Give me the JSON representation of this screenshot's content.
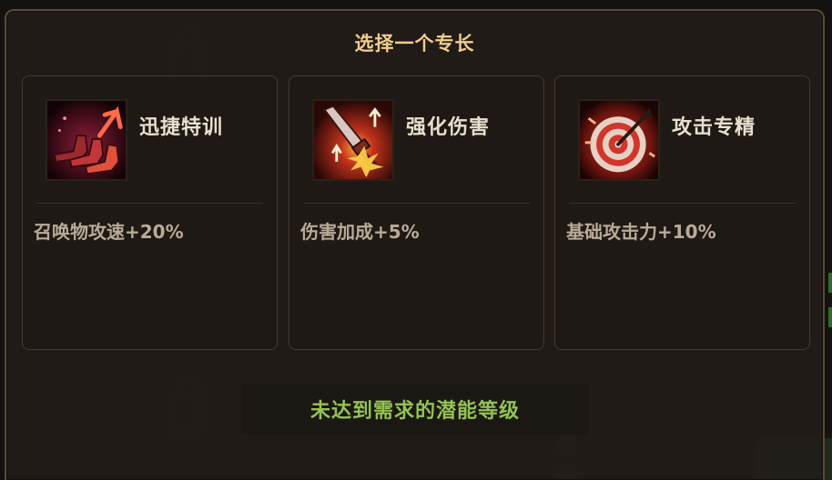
{
  "dialog": {
    "title": "选择一个专长",
    "status_message": "未达到需求的潜能等级"
  },
  "perks": [
    {
      "name": "迅捷特训",
      "description": "召唤物攻速+20%",
      "icon": "running-boots-icon"
    },
    {
      "name": "强化伤害",
      "description": "伤害加成+5%",
      "icon": "sword-burst-icon"
    },
    {
      "name": "攻击专精",
      "description": "基础攻击力+10%",
      "icon": "target-arrow-icon"
    }
  ],
  "colors": {
    "title": "#f0cd8c",
    "perk_name": "#e8e0cf",
    "perk_desc": "#b9ab96",
    "status_ok": "#93c254",
    "panel_border": "#5a4a38"
  }
}
